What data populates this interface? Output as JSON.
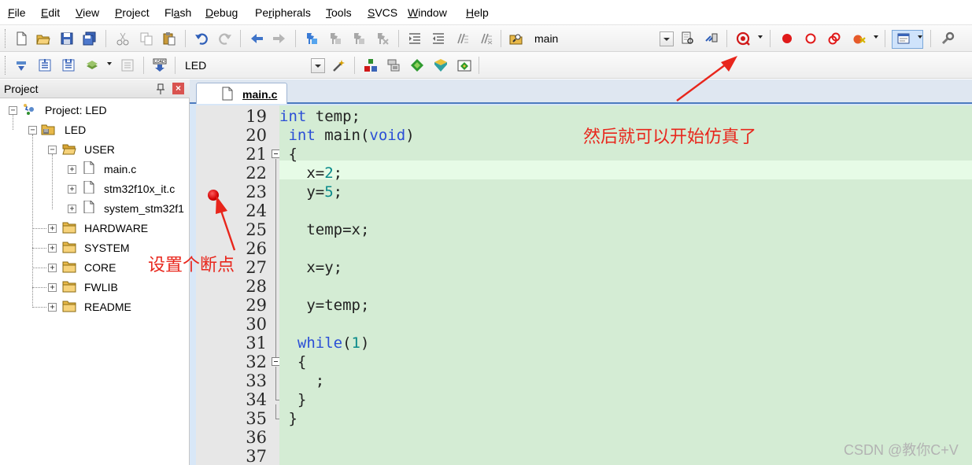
{
  "menu": {
    "items": [
      {
        "label": "File",
        "accel": "F"
      },
      {
        "label": "Edit",
        "accel": "E"
      },
      {
        "label": "View",
        "accel": "V"
      },
      {
        "label": "Project",
        "accel": "P"
      },
      {
        "label": "Flash",
        "accel": "a"
      },
      {
        "label": "Debug",
        "accel": "D"
      },
      {
        "label": "Peripherals",
        "accel": "r"
      },
      {
        "label": "Tools",
        "accel": "T"
      },
      {
        "label": "SVCS",
        "accel": "S"
      },
      {
        "label": "Window",
        "accel": "W"
      },
      {
        "label": "Help",
        "accel": "H"
      }
    ]
  },
  "toolbar1": {
    "find_combo_value": "main",
    "icons": [
      "new-file-icon",
      "open-file-icon",
      "save-icon",
      "save-all-icon",
      "cut-icon",
      "copy-icon",
      "paste-icon",
      "undo-icon",
      "redo-icon",
      "nav-back-icon",
      "nav-forward-icon",
      "bookmark-icon",
      "bookmark-prev-icon",
      "bookmark-next-icon",
      "bookmark-clear-icon",
      "indent-icon",
      "unindent-icon",
      "comment-icon",
      "uncomment-icon",
      "find-in-files-icon",
      "find-icon",
      "incremental-find-icon",
      "start-debug-icon",
      "insert-breakpoint-icon",
      "enable-breakpoint-icon",
      "disable-breakpoints-icon",
      "kill-breakpoints-icon",
      "window-layout-icon",
      "configure-icon"
    ]
  },
  "toolbar2": {
    "target_value": "LED",
    "icons": [
      "translate-icon",
      "build-icon",
      "rebuild-icon",
      "batch-build-icon",
      "stop-build-icon",
      "download-icon",
      "target-options-icon",
      "manage-components-icon",
      "select-packs-icon",
      "pack-installer-icon",
      "rte-icon",
      "event-recorder-icon"
    ]
  },
  "project": {
    "title": "Project",
    "close_glyph": "×",
    "root": "Project: LED",
    "target": "LED",
    "groups": [
      {
        "name": "USER",
        "expanded": true,
        "files": [
          "main.c",
          "stm32f10x_it.c",
          "system_stm32f1"
        ]
      },
      {
        "name": "HARDWARE"
      },
      {
        "name": "SYSTEM"
      },
      {
        "name": "CORE"
      },
      {
        "name": "FWLIB"
      },
      {
        "name": "README"
      }
    ]
  },
  "editor": {
    "tab_label": "main.c",
    "current_line": 22,
    "breakpoint_line": 22,
    "line_numbers": [
      "19",
      "20",
      "21",
      "22",
      "23",
      "24",
      "25",
      "26",
      "27",
      "28",
      "29",
      "30",
      "31",
      "32",
      "33",
      "34",
      "35",
      "36",
      "37"
    ],
    "lines": [
      [
        {
          "t": "int",
          "c": "kw"
        },
        {
          "t": " temp;"
        }
      ],
      [
        {
          "t": " "
        },
        {
          "t": "int",
          "c": "kw"
        },
        {
          "t": " main("
        },
        {
          "t": "void",
          "c": "kw"
        },
        {
          "t": ")"
        }
      ],
      [
        {
          "t": " {"
        }
      ],
      [
        {
          "t": "   x="
        },
        {
          "t": "2",
          "c": "num"
        },
        {
          "t": ";"
        }
      ],
      [
        {
          "t": "   y="
        },
        {
          "t": "5",
          "c": "num"
        },
        {
          "t": ";"
        }
      ],
      [],
      [
        {
          "t": "   temp=x;"
        }
      ],
      [],
      [
        {
          "t": "   x=y;"
        }
      ],
      [],
      [
        {
          "t": "   y=temp;"
        }
      ],
      [],
      [
        {
          "t": "  "
        },
        {
          "t": "while",
          "c": "kw"
        },
        {
          "t": "("
        },
        {
          "t": "1",
          "c": "num"
        },
        {
          "t": ")"
        }
      ],
      [
        {
          "t": "  {"
        }
      ],
      [
        {
          "t": "    ;"
        }
      ],
      [
        {
          "t": "  }"
        }
      ],
      [
        {
          "t": " }"
        }
      ],
      [],
      []
    ]
  },
  "annotations": {
    "breakpoint_note": "设置个断点",
    "debug_note": "然后就可以开始仿真了",
    "color": "#e8261c"
  },
  "watermark": "CSDN @教你C+V"
}
